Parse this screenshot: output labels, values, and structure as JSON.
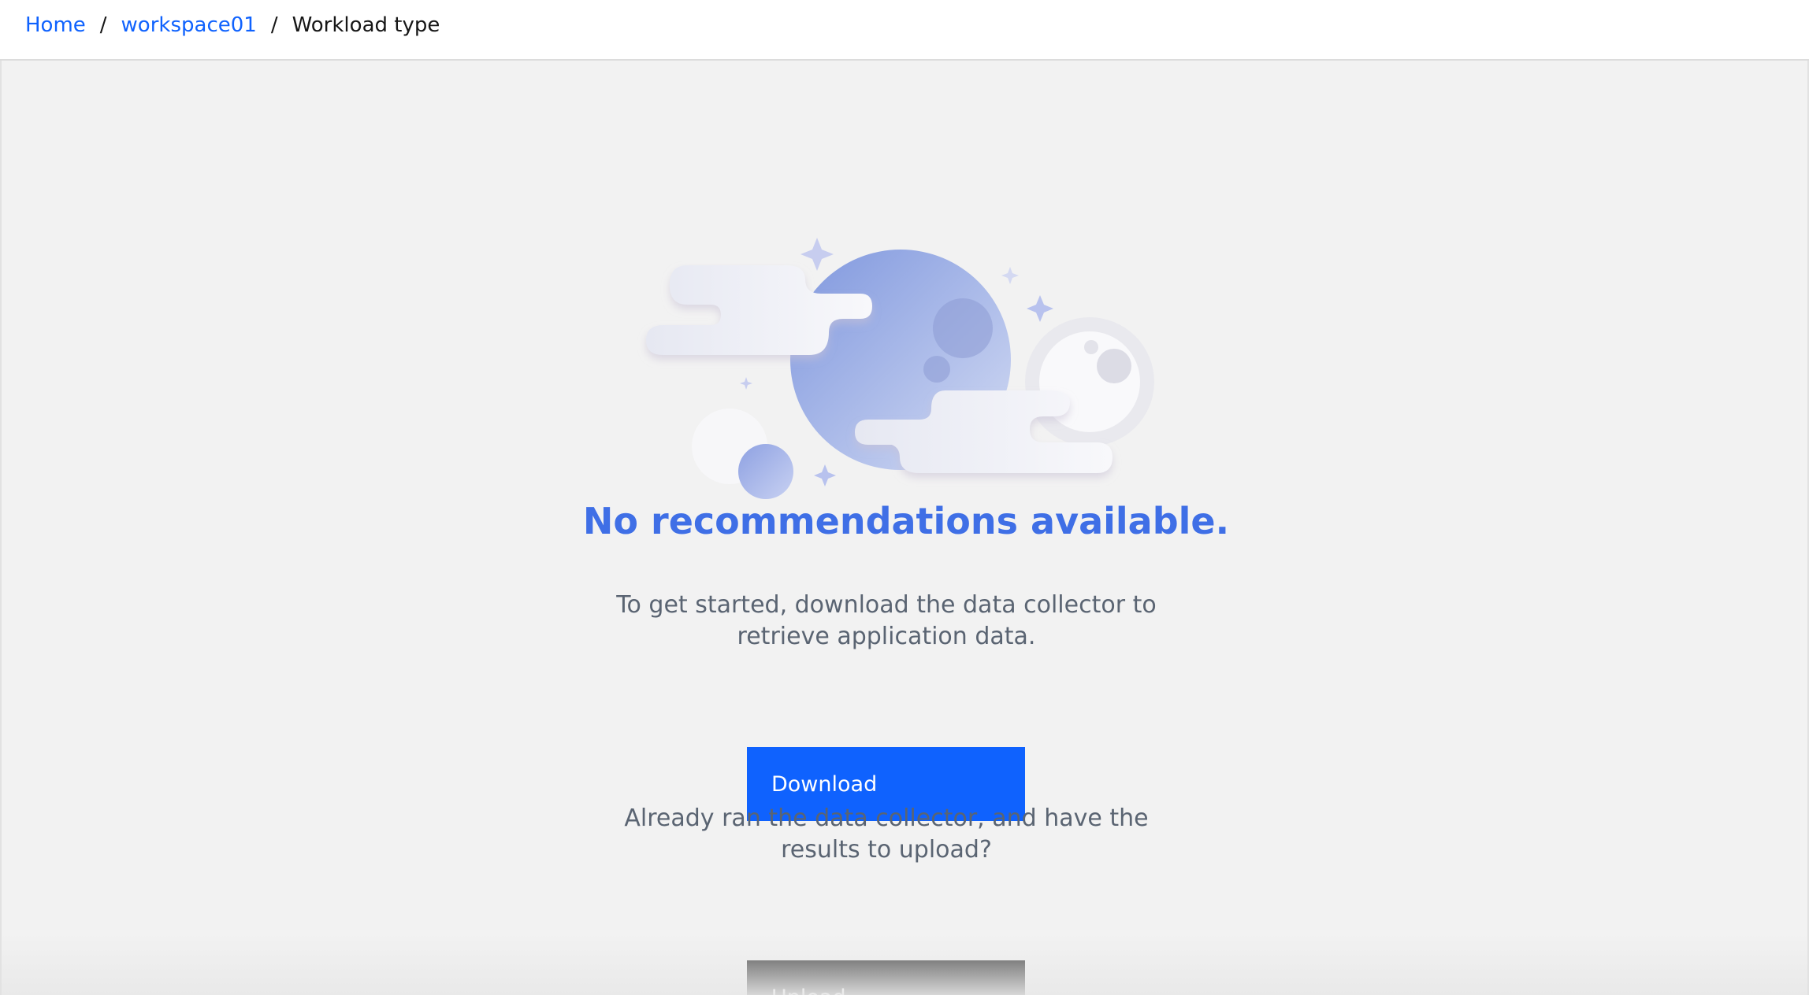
{
  "breadcrumb": {
    "items": [
      {
        "label": "Home",
        "link": true
      },
      {
        "label": "workspace01",
        "link": true
      },
      {
        "label": "Workload type",
        "link": false
      }
    ],
    "separator": "/"
  },
  "empty_state": {
    "title": "No recommendations available.",
    "description": "To get started, download the data collector to retrieve application data.",
    "download_button": "Download",
    "upload_prompt": "Already ran the data collector, and have the results to upload?",
    "upload_button": "Upload"
  },
  "colors": {
    "link": "#0f62fe",
    "title": "#3f6fe6",
    "primary_button": "#0f62fe",
    "secondary_button": "#393939",
    "background": "#f2f2f2"
  },
  "icons": {
    "illustration": "moon-clouds-empty-state-illustration"
  }
}
